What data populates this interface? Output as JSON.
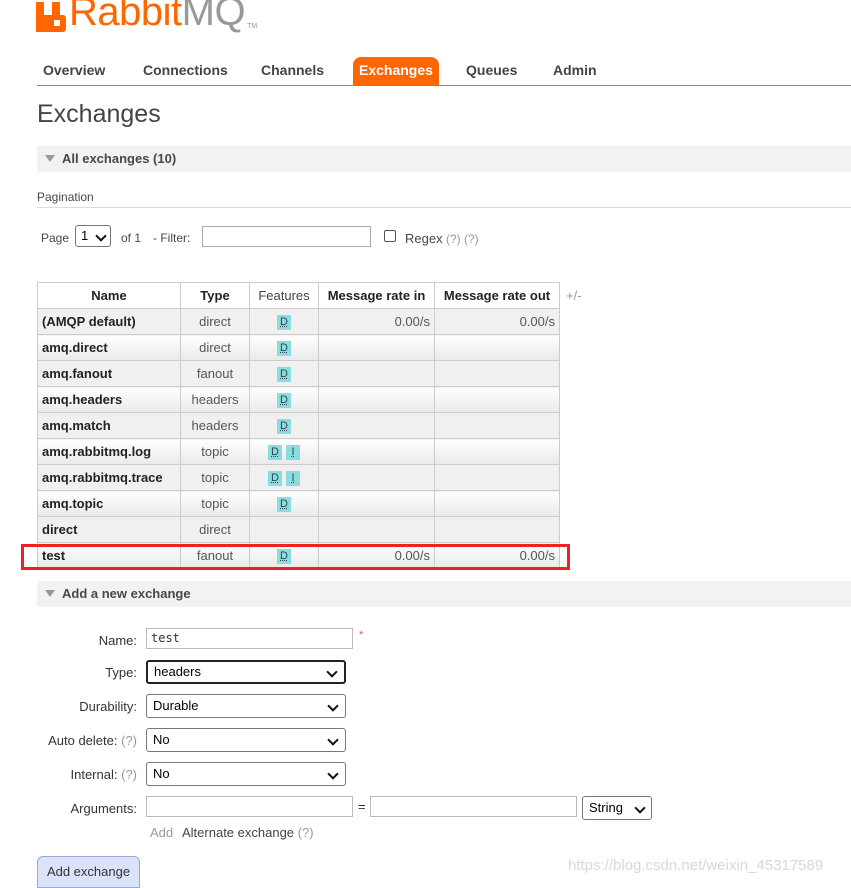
{
  "brand": {
    "part1": "Rabbit",
    "part2": "MQ",
    "tm": "TM"
  },
  "nav": [
    {
      "label": "Overview"
    },
    {
      "label": "Connections"
    },
    {
      "label": "Channels"
    },
    {
      "label": "Exchanges",
      "active": true
    },
    {
      "label": "Queues"
    },
    {
      "label": "Admin"
    }
  ],
  "page_title": "Exchanges",
  "all_exchanges": {
    "label": "All exchanges (10)"
  },
  "pagination": {
    "title": "Pagination",
    "page_label": "Page",
    "page_value": "1",
    "of_label": "of 1",
    "filter_label": "- Filter:",
    "filter_value": "",
    "regex_label": "Regex",
    "help1": "(?)",
    "help2": "(?)"
  },
  "table": {
    "headers": [
      "Name",
      "Type",
      "Features",
      "Message rate in",
      "Message rate out"
    ],
    "plusminus": "+/-",
    "rows": [
      {
        "name": "(AMQP default)",
        "type": "direct",
        "features": [
          "D"
        ],
        "rate_in": "0.00/s",
        "rate_out": "0.00/s"
      },
      {
        "name": "amq.direct",
        "type": "direct",
        "features": [
          "D"
        ],
        "rate_in": "",
        "rate_out": ""
      },
      {
        "name": "amq.fanout",
        "type": "fanout",
        "features": [
          "D"
        ],
        "rate_in": "",
        "rate_out": ""
      },
      {
        "name": "amq.headers",
        "type": "headers",
        "features": [
          "D"
        ],
        "rate_in": "",
        "rate_out": ""
      },
      {
        "name": "amq.match",
        "type": "headers",
        "features": [
          "D"
        ],
        "rate_in": "",
        "rate_out": ""
      },
      {
        "name": "amq.rabbitmq.log",
        "type": "topic",
        "features": [
          "D",
          "I"
        ],
        "rate_in": "",
        "rate_out": ""
      },
      {
        "name": "amq.rabbitmq.trace",
        "type": "topic",
        "features": [
          "D",
          "I"
        ],
        "rate_in": "",
        "rate_out": ""
      },
      {
        "name": "amq.topic",
        "type": "topic",
        "features": [
          "D"
        ],
        "rate_in": "",
        "rate_out": ""
      },
      {
        "name": "direct",
        "type": "direct",
        "features": [],
        "rate_in": "",
        "rate_out": ""
      },
      {
        "name": "test",
        "type": "fanout",
        "features": [
          "D"
        ],
        "rate_in": "0.00/s",
        "rate_out": "0.00/s"
      }
    ]
  },
  "add_exchange": {
    "label": "Add a new exchange",
    "name_label": "Name:",
    "name_value": "test",
    "required_mark": "*",
    "type_label": "Type:",
    "type_value": "headers",
    "durability_label": "Durability:",
    "durability_value": "Durable",
    "auto_delete_label": "Auto delete:",
    "auto_delete_value": "No",
    "internal_label": "Internal:",
    "internal_value": "No",
    "help": "(?)",
    "arguments_label": "Arguments:",
    "equals": "=",
    "arg_type_value": "String",
    "add_link": "Add",
    "alt_exchange_link": "Alternate exchange",
    "submit_label": "Add exchange"
  },
  "watermark": "https://blog.csdn.net/weixin_45317589",
  "colors": {
    "accent": "#ff6600",
    "highlight": "#e22222",
    "badge": "#88dddd"
  }
}
